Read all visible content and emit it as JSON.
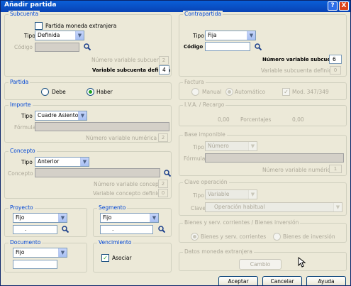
{
  "window": {
    "title": "Añadir partida",
    "help_label": "?",
    "close_label": "X"
  },
  "subcuenta": {
    "legend": "Subcuenta",
    "moneda_extranjera": {
      "label": "Partida moneda extranjera",
      "checked": false
    },
    "tipo_label": "Tipo",
    "tipo_value": "Definida",
    "codigo_label": "Código",
    "num_var_label": "Número variable subcuenta",
    "num_var_value": "2",
    "var_def_label": "Variable subcuenta definida",
    "var_def_value": "4"
  },
  "contrapartida": {
    "legend": "Contrapartida",
    "tipo_label": "Tipo",
    "tipo_value": "Fija",
    "codigo_label": "Código",
    "num_var_label": "Número variable subcuenta",
    "num_var_value": "6",
    "var_def_label": "Variable subcuenta definida",
    "var_def_value": "0"
  },
  "partida": {
    "legend": "Partida",
    "debe_label": "Debe",
    "haber_label": "Haber",
    "selected": "Haber"
  },
  "factura": {
    "legend": "Factura",
    "manual_label": "Manual",
    "automatico_label": "Automático",
    "selected": "Automático",
    "mod_label": "Mod. 347/349",
    "mod_checked": true
  },
  "importe": {
    "legend": "Importe",
    "tipo_label": "Tipo",
    "tipo_value": "Cuadre Asiento",
    "formula_label": "Fórmula",
    "num_var_label": "Número variable numérica",
    "num_var_value": "2"
  },
  "iva": {
    "legend": "I.V.A. / Recargo",
    "value1": "0,00",
    "porcentajes_label": "Porcentajes",
    "value2": "0,00"
  },
  "base_imponible": {
    "legend": "Base imponible",
    "tipo_label": "Tipo",
    "tipo_value": "Número",
    "formula_label": "Fórmula",
    "num_var_label": "Número variable numérica",
    "num_var_value": "1"
  },
  "concepto": {
    "legend": "Concepto",
    "tipo_label": "Tipo",
    "tipo_value": "Anterior",
    "concepto_label": "Concepto",
    "num_var_label": "Número variable concepto",
    "num_var_value": "2",
    "var_def_label": "Variable concepto definida",
    "var_def_value": "0"
  },
  "clave_operacion": {
    "legend": "Clave operación",
    "tipo_label": "Tipo",
    "tipo_value": "Variable",
    "clave_label": "Clave",
    "clave_value": "Operación habitual"
  },
  "proyecto": {
    "legend": "Proyecto",
    "tipo_value": "Fijo",
    "input_value": "."
  },
  "segmento": {
    "legend": "Segmento",
    "tipo_value": "Fijo",
    "input_value": "."
  },
  "bienes": {
    "legend": "Bienes y serv. corrientes / Bienes inversión",
    "corrientes_label": "Bienes y serv. corrientes",
    "inversion_label": "Bienes de inversión",
    "selected": "corrientes"
  },
  "documento": {
    "legend": "Documento",
    "tipo_value": "Fijo"
  },
  "vencimiento": {
    "legend": "Vencimiento",
    "asociar_label": "Asociar",
    "asociar_checked": true
  },
  "moneda_extranjera": {
    "legend": "Datos moneda extranjera",
    "cambio_label": "Cambio"
  },
  "buttons": {
    "aceptar": "Aceptar",
    "cancelar": "Cancelar",
    "ayuda": "Ayuda"
  },
  "icons": {
    "search": "magnifier-icon",
    "dropdown": "chevron-down-icon",
    "check": "check-icon"
  },
  "colors": {
    "title_bar": "#0a5fd8",
    "legend_text": "#0046d5",
    "window_bg": "#ece9d8",
    "close_button": "#d9431c"
  }
}
